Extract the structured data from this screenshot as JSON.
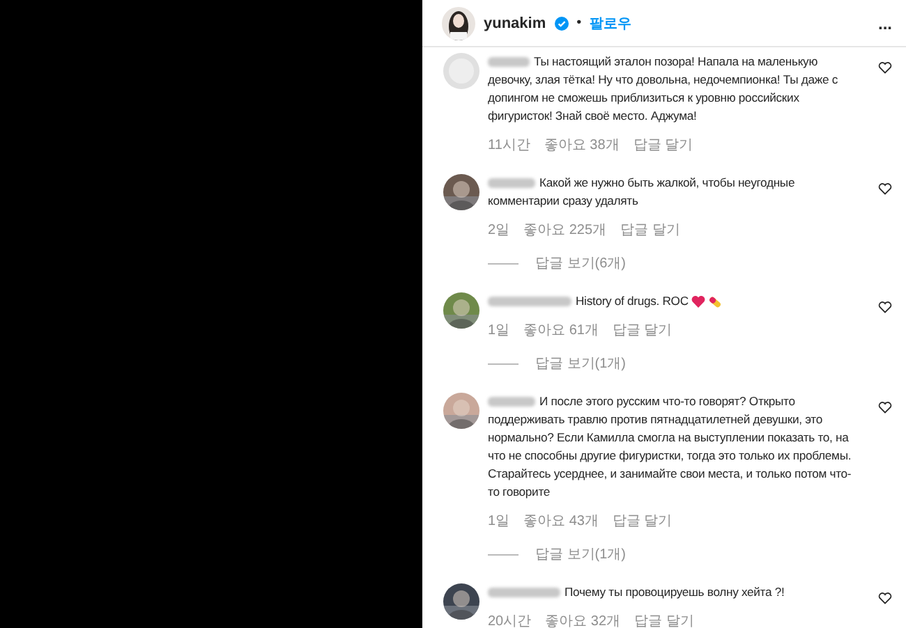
{
  "header": {
    "username": "yunakim",
    "verified": true,
    "separator": "•",
    "follow": "팔로우",
    "more": "..."
  },
  "comments": [
    {
      "text": "Ты настоящий эталон позора! Напала на маленькую девочку, злая тётка! Ну что довольна, недочемпионка! Ты даже с допингом не сможешь приблизиться к уровню российских фигуристок! Знай своё место. Аджума!",
      "time": "11시간",
      "likes": "좋아요 38개",
      "reply": "답글 달기"
    },
    {
      "text": "Какой же нужно быть жалкой, чтобы неугодные комментарии сразу удалять",
      "time": "2일",
      "likes": "좋아요 225개",
      "reply": "답글 달기",
      "view_replies": "답글 보기(6개)"
    },
    {
      "text": "History of drugs. ROC",
      "emoji": true,
      "time": "1일",
      "likes": "좋아요 61개",
      "reply": "답글 달기",
      "view_replies": "답글 보기(1개)"
    },
    {
      "text": "И после этого русским что-то говорят? Открыто поддерживать травлю против пятнадцатилетней девушки, это нормально? Если Камилла смогла на выступлении показать то, на что не способны другие фигуристки, тогда это только их проблемы. Старайтесь усерднее, и занимайте свои места, и только потом что-то говорите",
      "time": "1일",
      "likes": "좋아요 43개",
      "reply": "답글 달기",
      "view_replies": "답글 보기(1개)"
    },
    {
      "text": "Почему ты провоцируешь волну хейта ?!",
      "time": "20시간",
      "likes": "좋아요 32개",
      "reply": "답글 달기"
    }
  ]
}
